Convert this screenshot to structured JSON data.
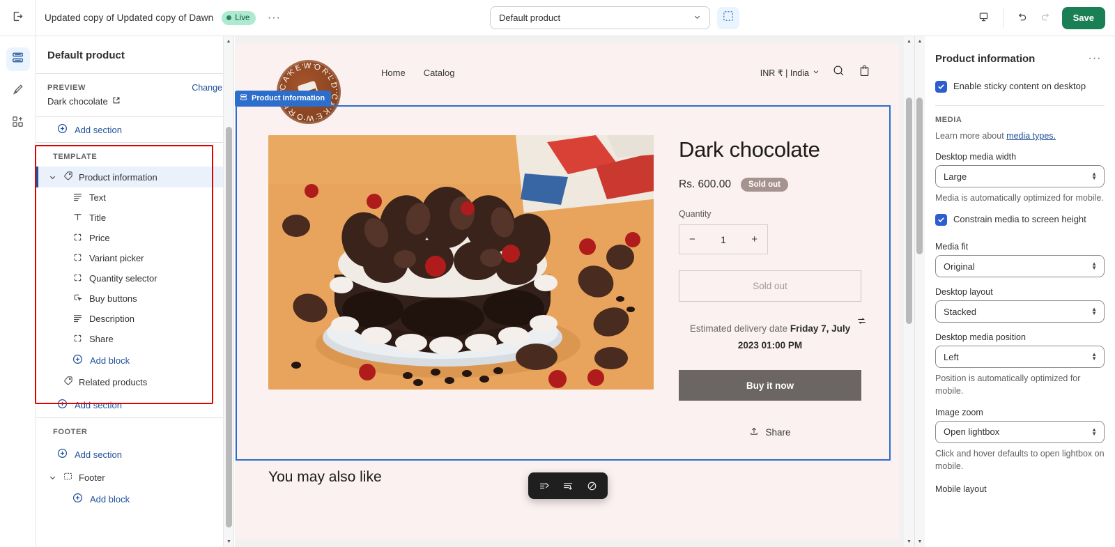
{
  "topbar": {
    "exit_icon": "exit-icon",
    "theme_name": "Updated copy of Updated copy of Dawn",
    "live_label": "Live",
    "more_label": "···",
    "page_select_value": "Default product",
    "inspect_icon": "inspector-icon",
    "device_icon": "desktop-icon",
    "undo_icon": "undo-icon",
    "redo_icon": "redo-icon",
    "save_label": "Save"
  },
  "rail": {
    "items": [
      {
        "name": "sections-icon",
        "active": true
      },
      {
        "name": "theme-settings-icon",
        "active": false
      },
      {
        "name": "apps-icon",
        "active": false
      }
    ]
  },
  "sidebar": {
    "title": "Default product",
    "preview_label": "PREVIEW",
    "change_label": "Change",
    "preview_value": "Dark chocolate",
    "add_section_top": "Add section",
    "template_label": "TEMPLATE",
    "section": {
      "label": "Product information",
      "icon": "tag-icon",
      "selected": true,
      "blocks": [
        {
          "label": "Text",
          "icon": "text-lines-icon"
        },
        {
          "label": "Title",
          "icon": "title-t-icon"
        },
        {
          "label": "Price",
          "icon": "dashed-square-icon"
        },
        {
          "label": "Variant picker",
          "icon": "dashed-square-icon"
        },
        {
          "label": "Quantity selector",
          "icon": "dashed-square-icon"
        },
        {
          "label": "Buy buttons",
          "icon": "cursor-button-icon"
        },
        {
          "label": "Description",
          "icon": "text-lines-icon"
        },
        {
          "label": "Share",
          "icon": "dashed-square-icon"
        }
      ],
      "add_block_label": "Add block"
    },
    "related_products": "Related products",
    "add_section_mid": "Add section",
    "footer_label": "FOOTER",
    "add_section_footer": "Add section",
    "footer_section": "Footer",
    "footer_add_block": "Add block"
  },
  "preview": {
    "section_badge": "Product information",
    "store": {
      "logo_text": "CAKEWORLD",
      "nav": [
        "Home",
        "Catalog"
      ],
      "currency": "INR ₹ | India",
      "search_icon": "search-icon",
      "cart_icon": "cart-icon"
    },
    "product": {
      "title": "Dark chocolate",
      "price": "Rs. 600.00",
      "availability_badge": "Sold out",
      "quantity_label": "Quantity",
      "quantity_value": "1",
      "qty_minus": "−",
      "qty_plus": "+",
      "sold_out_button": "Sold out",
      "delivery_prefix": "Estimated delivery date ",
      "delivery_date": "Friday 7, July 2023 01:00 PM",
      "buy_now_button": "Buy it now",
      "share_label": "Share"
    },
    "recommendations_heading": "You may also like",
    "toolbar_icons": [
      "move-section-up-icon",
      "move-section-down-icon",
      "hide-section-icon"
    ]
  },
  "right_panel": {
    "title": "Product information",
    "more_label": "···",
    "sticky_checkbox_label": "Enable sticky content on desktop",
    "media_group_label": "MEDIA",
    "media_help_prefix": "Learn more about ",
    "media_help_link": "media types.",
    "fields": [
      {
        "label": "Desktop media width",
        "value": "Large",
        "help": "Media is automatically optimized for mobile."
      },
      {
        "label": "Media fit",
        "value": "Original",
        "help": ""
      },
      {
        "label": "Desktop layout",
        "value": "Stacked",
        "help": ""
      },
      {
        "label": "Desktop media position",
        "value": "Left",
        "help": "Position is automatically optimized for mobile."
      },
      {
        "label": "Image zoom",
        "value": "Open lightbox",
        "help": "Click and hover defaults to open lightbox on mobile."
      }
    ],
    "constrain_checkbox_label": "Constrain media to screen height",
    "mobile_layout_label": "Mobile layout"
  },
  "colors": {
    "accent_blue": "#2c6ecb",
    "link_blue": "#1f5199",
    "save_green": "#1a7f54",
    "live_badge_bg": "#aee9d1",
    "highlight_red": "#e00000",
    "store_bg": "#faf1f0",
    "sold_out_badge": "#a6938f",
    "buy_now_bg": "#6b6664"
  }
}
